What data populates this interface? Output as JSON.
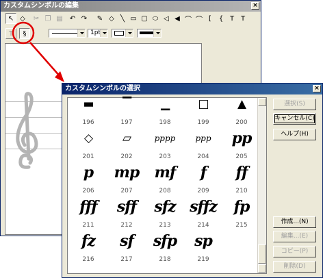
{
  "editor": {
    "title": "カスタムシンボルの編集",
    "close": "×",
    "toolbar1": [
      {
        "name": "select-arrow-icon",
        "glyph": "↖"
      },
      {
        "name": "eraser-icon",
        "glyph": "◇"
      },
      {
        "name": "cut-icon",
        "glyph": "✂"
      },
      {
        "name": "copy-icon",
        "glyph": "❐"
      },
      {
        "name": "paste-icon",
        "glyph": "▤"
      },
      {
        "name": "undo-icon",
        "glyph": "↶"
      },
      {
        "name": "redo-icon",
        "glyph": "↷"
      },
      {
        "name": "pencil-icon",
        "glyph": "✎"
      },
      {
        "name": "fill-icon",
        "glyph": "◇"
      },
      {
        "name": "line-icon",
        "glyph": "╲"
      },
      {
        "name": "rectangle-icon",
        "glyph": "▭"
      },
      {
        "name": "rounded-rectangle-icon",
        "glyph": "▢"
      },
      {
        "name": "ellipse-icon",
        "glyph": "⬭"
      },
      {
        "name": "polygon-icon",
        "glyph": "◁"
      },
      {
        "name": "filled-polygon-icon",
        "glyph": "◀"
      },
      {
        "name": "arc-icon",
        "glyph": "⌒"
      },
      {
        "name": "filled-arc-icon",
        "glyph": "⌒"
      },
      {
        "name": "bracket-icon",
        "glyph": "["
      },
      {
        "name": "brace-icon",
        "glyph": "{"
      },
      {
        "name": "text-icon",
        "glyph": "T"
      },
      {
        "name": "symbol-text-icon",
        "glyph": "T"
      }
    ],
    "toolbar2": {
      "text_tool": "T",
      "symbol_tool": "§",
      "line_width": "1pt"
    }
  },
  "dialog": {
    "title": "カスタムシンボルの選択",
    "close": "×",
    "symbols": [
      {
        "num": "196",
        "glyph": "▬",
        "size": "mid"
      },
      {
        "num": "197",
        "glyph": "▔",
        "size": "mid"
      },
      {
        "num": "198",
        "glyph": "▁",
        "size": "mid"
      },
      {
        "num": "199",
        "glyph": "□",
        "size": "mid"
      },
      {
        "num": "200",
        "glyph": "▲",
        "size": "mid"
      },
      {
        "num": "201",
        "glyph": "◇",
        "size": "mid"
      },
      {
        "num": "202",
        "glyph": "▱",
        "size": "mid"
      },
      {
        "num": "203",
        "glyph": "pppp",
        "size": "small"
      },
      {
        "num": "204",
        "glyph": "ppp",
        "size": "small"
      },
      {
        "num": "205",
        "glyph": "pp",
        "size": "big"
      },
      {
        "num": "206",
        "glyph": "p",
        "size": "big"
      },
      {
        "num": "207",
        "glyph": "mp",
        "size": "big"
      },
      {
        "num": "208",
        "glyph": "mf",
        "size": "big"
      },
      {
        "num": "209",
        "glyph": "f",
        "size": "big"
      },
      {
        "num": "210",
        "glyph": "ff",
        "size": "big"
      },
      {
        "num": "211",
        "glyph": "fff",
        "size": "big"
      },
      {
        "num": "212",
        "glyph": "sff",
        "size": "big"
      },
      {
        "num": "213",
        "glyph": "sfz",
        "size": "big"
      },
      {
        "num": "214",
        "glyph": "sffz",
        "size": "big"
      },
      {
        "num": "215",
        "glyph": "fp",
        "size": "big"
      },
      {
        "num": "216",
        "glyph": "fz",
        "size": "big"
      },
      {
        "num": "217",
        "glyph": "sf",
        "size": "big"
      },
      {
        "num": "218",
        "glyph": "sfp",
        "size": "big"
      },
      {
        "num": "219",
        "glyph": "sp",
        "size": "big"
      }
    ],
    "buttons": {
      "select": "選択(S)",
      "cancel": "キャンセル(C)",
      "help": "ヘルプ(H)",
      "create": "作成...(N)",
      "edit": "編集...(E)",
      "copy": "コピー(P)",
      "delete": "削除(D)"
    }
  },
  "colors": {
    "annotation": "#e00000",
    "title_active": "#0a246a",
    "title_inactive": "#808080"
  }
}
